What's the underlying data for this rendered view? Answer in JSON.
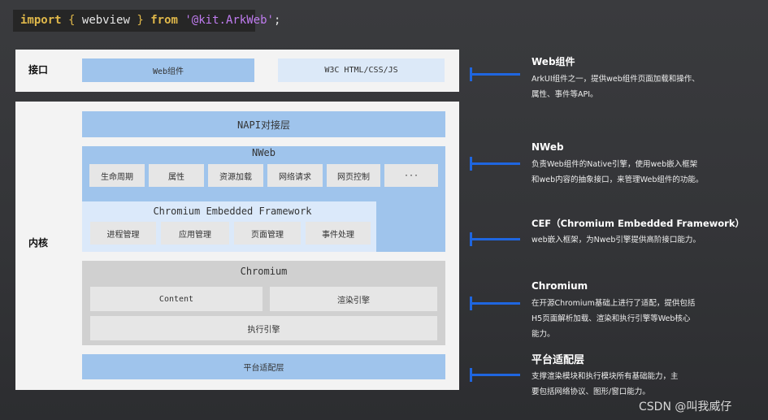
{
  "code": {
    "import_kw": "import",
    "open_brace": "{",
    "identifier": "webview",
    "close_brace": "}",
    "from_kw": "from",
    "module": "'@kit.ArkWeb'",
    "semicolon": ";"
  },
  "interface_panel": {
    "label": "接口",
    "web_component": "Web组件",
    "w3c": "W3C HTML/CSS/JS"
  },
  "kernel_panel": {
    "label": "内核",
    "napi": "NAPI对接层",
    "nweb": {
      "title": "NWeb",
      "cells": [
        "生命周期",
        "属性",
        "资源加载",
        "网络请求",
        "网页控制",
        "···"
      ]
    },
    "cef": {
      "title": "Chromium Embedded Framework",
      "cells": [
        "进程管理",
        "应用管理",
        "页面管理",
        "事件处理"
      ]
    },
    "chromium": {
      "title": "Chromium",
      "content": "Content",
      "render": "渲染引擎",
      "exec": "执行引擎"
    },
    "platform": "平台适配层"
  },
  "annotations": [
    {
      "title": "Web组件",
      "lines": [
        "ArkUI组件之一，提供web组件页面加载和操作、",
        "属性、事件等API。"
      ]
    },
    {
      "title": "NWeb",
      "lines": [
        "负责Web组件的Native引擎，使用web嵌入框架",
        "和web内容的抽象接口，来管理Web组件的功能。"
      ]
    },
    {
      "title": "CEF（Chromium Embedded Framework）",
      "lines": [
        "web嵌入框架，为Nweb引擎提供高阶接口能力。"
      ]
    },
    {
      "title": "Chromium",
      "lines": [
        "在开源Chromium基础上进行了适配，提供包括",
        "H5页面解析加载、渲染和执行引擎等Web核心",
        "能力。"
      ]
    },
    {
      "title": "平台适配层",
      "lines": [
        "支撑渲染模块和执行模块所有基础能力，主",
        "要包括网络协议、图形/窗口能力。"
      ]
    }
  ],
  "watermark": "CSDN @叫我威仔",
  "colors": {
    "accent": "#1f66e0",
    "box_blue": "#9fc4ec",
    "box_light_blue": "#dce9f8",
    "chromium_gray": "#d0d0d0"
  }
}
